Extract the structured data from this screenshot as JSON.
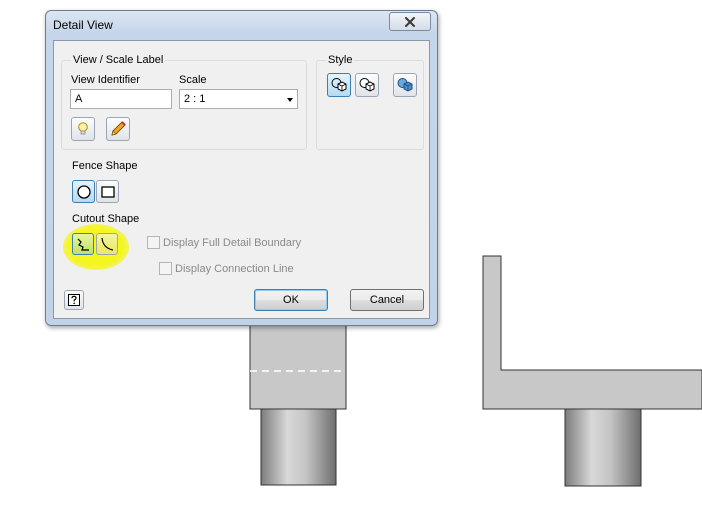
{
  "dialog": {
    "title": "Detail View",
    "close_glyph": "✕",
    "view_scale_group": {
      "title": "View / Scale Label",
      "view_identifier_label": "View Identifier",
      "view_identifier_value": "A",
      "scale_label": "Scale",
      "scale_value": "2 : 1",
      "toggle_visibility_icon": "lightbulb-icon",
      "edit_label_icon": "pencil-icon"
    },
    "style_group": {
      "title": "Style",
      "buttons": [
        "hidden-lines-style-icon",
        "hidden-lines-removed-style-icon",
        "shaded-style-icon"
      ]
    },
    "fence_shape": {
      "label": "Fence Shape",
      "options": [
        "circular-fence-icon",
        "rectangular-fence-icon"
      ],
      "selected": "circular-fence-icon"
    },
    "cutout_shape": {
      "label": "Cutout Shape",
      "options": [
        "jagged-cutout-icon",
        "smooth-cutout-icon"
      ],
      "selected": "jagged-cutout-icon",
      "highlight_color": "#f5f514"
    },
    "display_full_detail_boundary": {
      "label": "Display Full Detail Boundary",
      "checked": false,
      "enabled": false
    },
    "display_connection_line": {
      "label": "Display Connection Line",
      "checked": false,
      "enabled": false
    },
    "help_icon": "help-icon",
    "ok_label": "OK",
    "cancel_label": "Cancel"
  },
  "colors": {
    "accent": "#3c7fb1",
    "window_frame": "#c6d6ea",
    "dialog_bg": "#f0f0f0",
    "part_shade": "#c8c8c8"
  }
}
